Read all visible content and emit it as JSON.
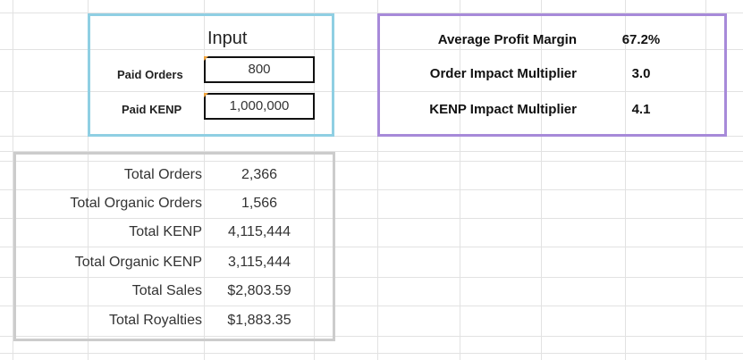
{
  "input": {
    "title": "Input",
    "paid_orders_label": "Paid Orders",
    "paid_orders_value": "800",
    "paid_kenp_label": "Paid KENP",
    "paid_kenp_value": "1,000,000"
  },
  "metrics": [
    {
      "label": "Average Profit Margin",
      "value": "67.2%"
    },
    {
      "label": "Order Impact Multiplier",
      "value": "3.0"
    },
    {
      "label": "KENP Impact Multiplier",
      "value": "4.1"
    }
  ],
  "results": [
    {
      "label": "Total Orders",
      "value": "2,366"
    },
    {
      "label": "Total Organic Orders",
      "value": "1,566"
    },
    {
      "label": "Total KENP",
      "value": "4,115,444"
    },
    {
      "label": "Total Organic KENP",
      "value": "3,115,444"
    },
    {
      "label": "Total Sales",
      "value": "$2,803.59"
    },
    {
      "label": "Total Royalties",
      "value": "$1,883.35"
    }
  ],
  "colors": {
    "input_border": "#8fcfe3",
    "metrics_border": "#a78ad9",
    "results_border": "#cccccc",
    "gridline": "#e2e2e2",
    "note_marker": "#f0a23a"
  }
}
